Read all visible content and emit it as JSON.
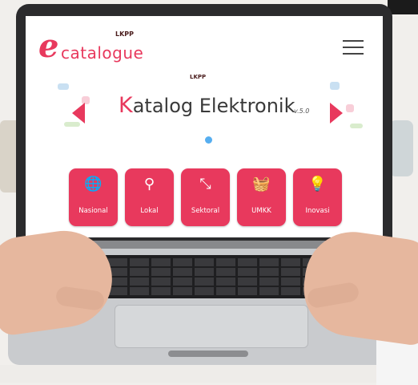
{
  "colors": {
    "accent": "#e8395d",
    "dot": "#56aef0",
    "lid": "#2b2b2d"
  },
  "header": {
    "logo_e": "e",
    "logo_text": "catalogue",
    "logo_lkpp": "LKPP",
    "menu_icon": "hamburger-icon"
  },
  "hero": {
    "lkpp": "LKPP",
    "title_first_letter": "K",
    "title_rest": "atalog Elektronik",
    "version": "v.5.0",
    "prev_icon": "chevron-left-icon",
    "next_icon": "chevron-right-icon"
  },
  "categories": [
    {
      "label": "Nasional",
      "icon": "globe-icon",
      "glyph": "🌐"
    },
    {
      "label": "Lokal",
      "icon": "location-globe-icon",
      "glyph": "⚲"
    },
    {
      "label": "Sektoral",
      "icon": "expand-icon",
      "glyph": "⤡"
    },
    {
      "label": "UMKK",
      "icon": "basket-icon",
      "glyph": "🧺"
    },
    {
      "label": "Inovasi",
      "icon": "lightbulb-icon",
      "glyph": "💡"
    }
  ]
}
